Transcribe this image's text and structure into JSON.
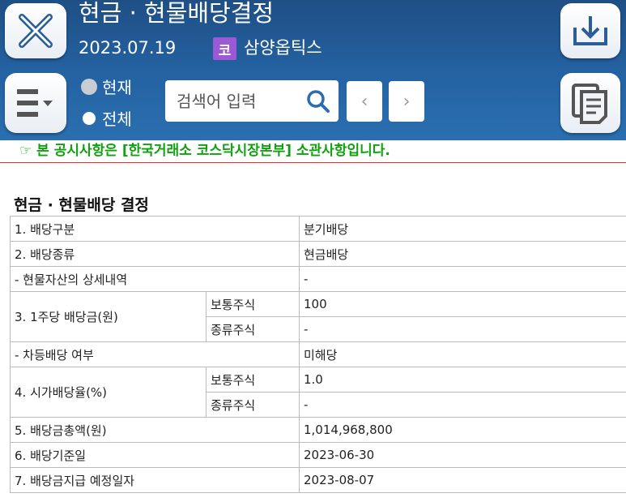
{
  "header": {
    "title": "현금 · 현물배당결정",
    "date": "2023.07.19",
    "market_badge": "코",
    "company": "삼양옵틱스",
    "badge_color": "#9b59d6"
  },
  "filter": {
    "option_current": "현재",
    "option_all": "전체",
    "selected": "전체"
  },
  "search": {
    "placeholder": "검색어 입력"
  },
  "nav": {
    "prev": "‹",
    "next": "›"
  },
  "notice": "☞ 본 공시사항은 [한국거래소 코스닥시장본부] 소관사항입니다.",
  "section_title": "현금 · 현물배당 결정",
  "table": {
    "r1_label": "1. 배당구분",
    "r1_value": "분기배당",
    "r2_label": "2. 배당종류",
    "r2_value": "현금배당",
    "r3_label": "- 현물자산의 상세내역",
    "r3_value": "-",
    "r4_label": "3. 1주당 배당금(원)",
    "r4_sub1": "보통주식",
    "r4_val1": "100",
    "r4_sub2": "종류주식",
    "r4_val2": "-",
    "r5_label": "- 차등배당 여부",
    "r5_value": "미해당",
    "r6_label": "4. 시가배당율(%)",
    "r6_sub1": "보통주식",
    "r6_val1": "1.0",
    "r6_sub2": "종류주식",
    "r6_val2": "-",
    "r7_label": "5. 배당금총액(원)",
    "r7_value": "1,014,968,800",
    "r8_label": "6. 배당기준일",
    "r8_value": "2023-06-30",
    "r9_label": "7. 배당금지급 예정일자",
    "r9_value": "2023-08-07"
  }
}
